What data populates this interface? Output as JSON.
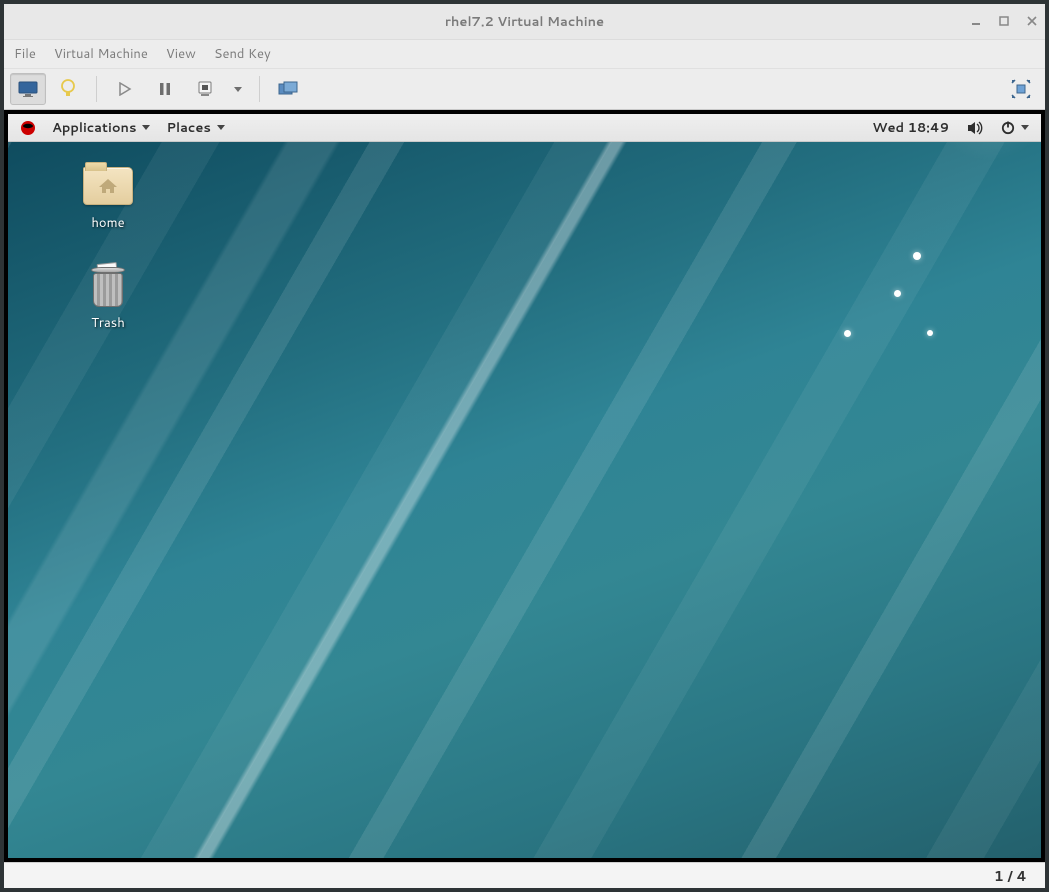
{
  "window": {
    "title": "rhel7.2 Virtual Machine"
  },
  "menubar": {
    "file": "File",
    "virtual_machine": "Virtual Machine",
    "view": "View",
    "send_key": "Send Key"
  },
  "toolbar": {
    "console_btn": "console-view",
    "lightbulb_btn": "details-view",
    "run_btn": "run",
    "pause_btn": "pause",
    "shutdown_btn": "shutdown",
    "shutdown_menu_btn": "shutdown-menu",
    "snapshots_btn": "snapshots",
    "fullscreen_btn": "fullscreen"
  },
  "guest_panel": {
    "applications": "Applications",
    "places": "Places",
    "clock": "Wed 18:49"
  },
  "desktop": {
    "home_label": "home",
    "trash_label": "Trash"
  },
  "statusbar": {
    "counter": "1 / 4"
  }
}
